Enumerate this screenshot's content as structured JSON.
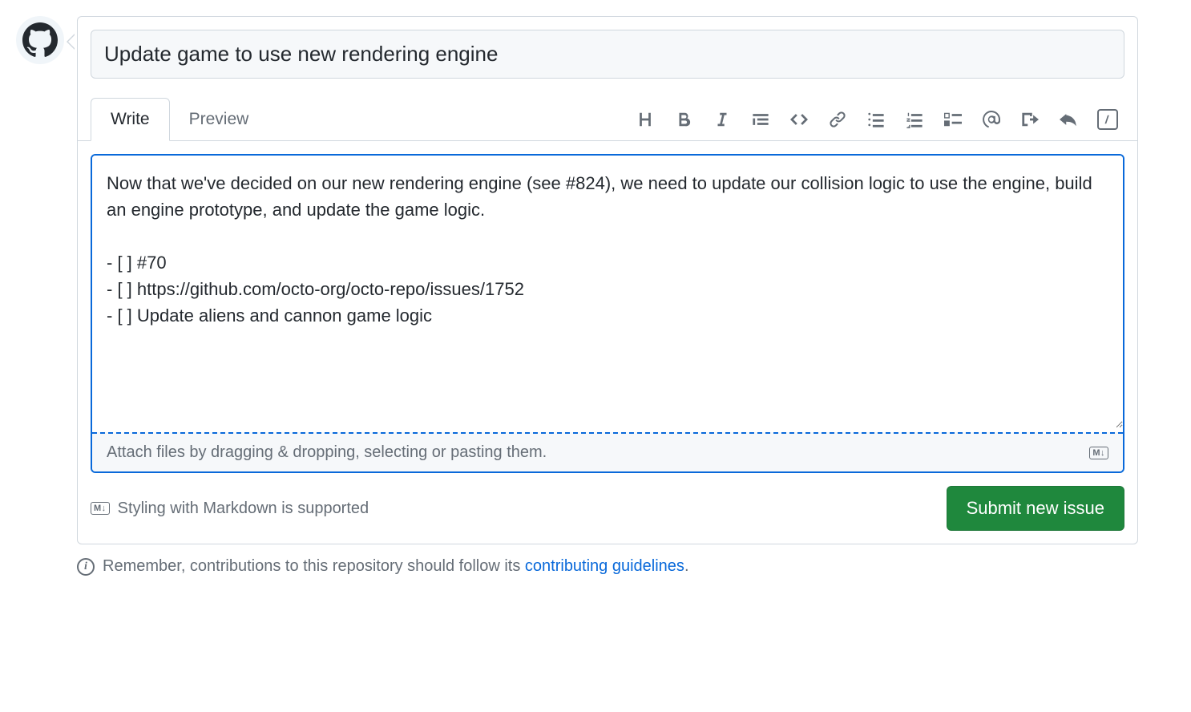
{
  "title_value": "Update game to use new rendering engine",
  "tabs": {
    "write": "Write",
    "preview": "Preview"
  },
  "toolbar_icons": {
    "heading": "heading-icon",
    "bold": "bold-icon",
    "italic": "italic-icon",
    "quote": "quote-icon",
    "code": "code-icon",
    "link": "link-icon",
    "ul": "unordered-list-icon",
    "ol": "ordered-list-icon",
    "task": "task-list-icon",
    "mention": "mention-icon",
    "crossref": "cross-reference-icon",
    "reply": "reply-icon",
    "slash": "slash-commands-icon"
  },
  "editor_value": "Now that we've decided on our new rendering engine (see #824), we need to update our collision logic to use the engine, build an engine prototype, and update the game logic.\n\n- [ ] #70\n- [ ] https://github.com/octo-org/octo-repo/issues/1752\n- [ ] Update aliens and cannon game logic",
  "attach_hint": "Attach files by dragging & dropping, selecting or pasting them.",
  "markdown_badge": "M↓",
  "markdown_support": "Styling with Markdown is supported",
  "submit_label": "Submit new issue",
  "guidelines": {
    "prefix": "Remember, contributions to this repository should follow its ",
    "link": "contributing guidelines",
    "suffix": "."
  }
}
